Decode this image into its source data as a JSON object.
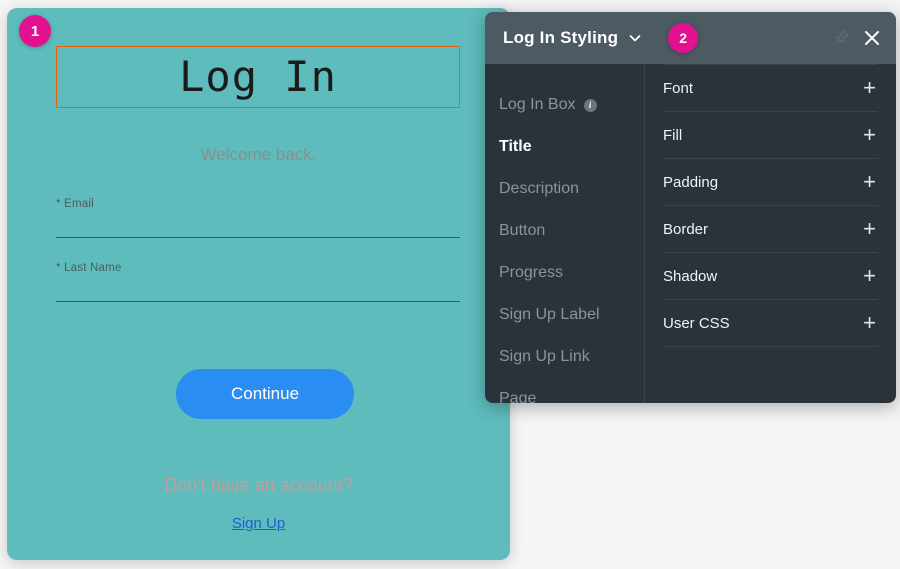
{
  "colors": {
    "login_card_bg": "#5fbcbc",
    "accent_badge": "#e3118f",
    "selection_border": "#e8620c",
    "continue_button": "#2a8df2",
    "panel_header": "#4c5a61",
    "panel_body": "#2b333a",
    "link_blue": "#1f5fd0"
  },
  "steps": {
    "badge_one": "1",
    "badge_two": "2"
  },
  "login_card": {
    "title": "Log In",
    "welcome": "Welcome back.",
    "fields": [
      {
        "label": "* Email",
        "value": "",
        "placeholder": ""
      },
      {
        "label": "* Last Name",
        "value": "",
        "placeholder": ""
      }
    ],
    "continue_label": "Continue",
    "signup_prompt": "Don't have an account?",
    "signup_link": "Sign Up"
  },
  "panel": {
    "title": "Log In Styling",
    "title_chevron_icon": "chevron-down-icon",
    "pin_icon": "pin-icon",
    "close_icon": "close-icon",
    "sidebar": {
      "items": [
        {
          "label": "Log In Box",
          "active": false,
          "info": true,
          "info_icon": "info-icon"
        },
        {
          "label": "Title",
          "active": true,
          "info": false
        },
        {
          "label": "Description",
          "active": false,
          "info": false
        },
        {
          "label": "Button",
          "active": false,
          "info": false
        },
        {
          "label": "Progress",
          "active": false,
          "info": false
        },
        {
          "label": "Sign Up Label",
          "active": false,
          "info": false
        },
        {
          "label": "Sign Up Link",
          "active": false,
          "info": false
        },
        {
          "label": "Page",
          "active": false,
          "info": false
        }
      ]
    },
    "properties": [
      {
        "label": "Font",
        "add_icon": "plus-icon"
      },
      {
        "label": "Fill",
        "add_icon": "plus-icon"
      },
      {
        "label": "Padding",
        "add_icon": "plus-icon"
      },
      {
        "label": "Border",
        "add_icon": "plus-icon"
      },
      {
        "label": "Shadow",
        "add_icon": "plus-icon"
      },
      {
        "label": "User CSS",
        "add_icon": "plus-icon"
      }
    ]
  }
}
